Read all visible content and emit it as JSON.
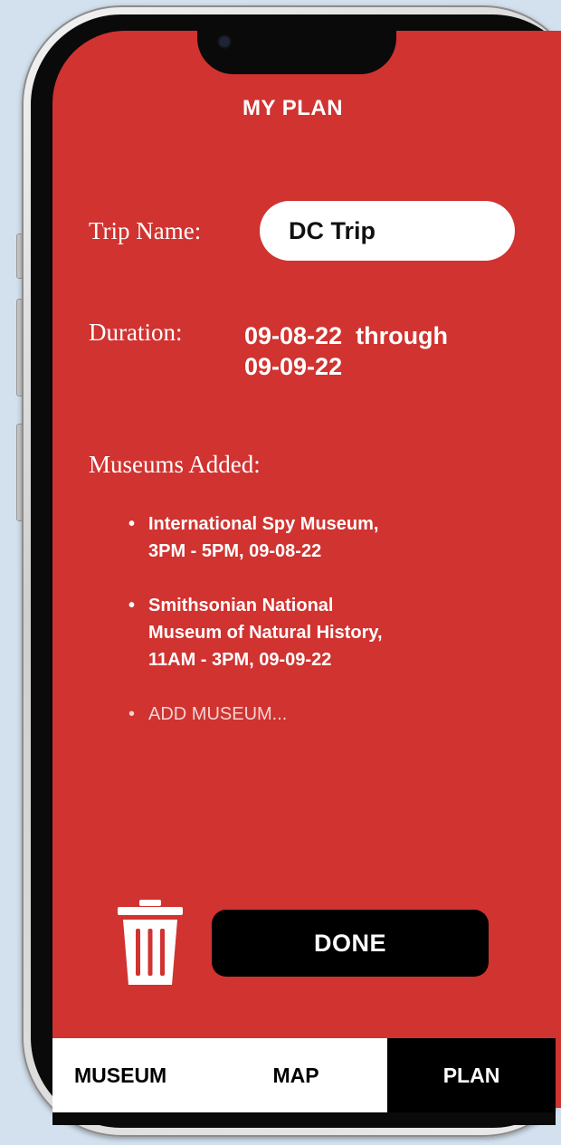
{
  "header": {
    "title": "MY PLAN"
  },
  "trip": {
    "name_label": "Trip Name:",
    "name_value": "DC Trip",
    "duration_label": "Duration:",
    "duration_line1": "09-08-22  through",
    "duration_line2": "09-09-22"
  },
  "museums": {
    "label": "Museums Added:",
    "items": [
      {
        "line1": "International Spy Museum,",
        "line2": "3PM - 5PM, 09-08-22"
      },
      {
        "line1": "Smithsonian National",
        "line2": "Museum of Natural History,",
        "line3": "11AM - 3PM, 09-09-22"
      }
    ],
    "add_label": "ADD MUSEUM..."
  },
  "actions": {
    "delete_icon": "trash-icon",
    "done_label": "DONE"
  },
  "tabs": [
    {
      "label": "MUSEUM",
      "active": false
    },
    {
      "label": "MAP",
      "active": false
    },
    {
      "label": "PLAN",
      "active": true
    }
  ],
  "colors": {
    "screen_background": "#d03330",
    "active_tab": "#000000",
    "inactive_tab": "#ffffff",
    "page_background": "#d3e1ef"
  }
}
